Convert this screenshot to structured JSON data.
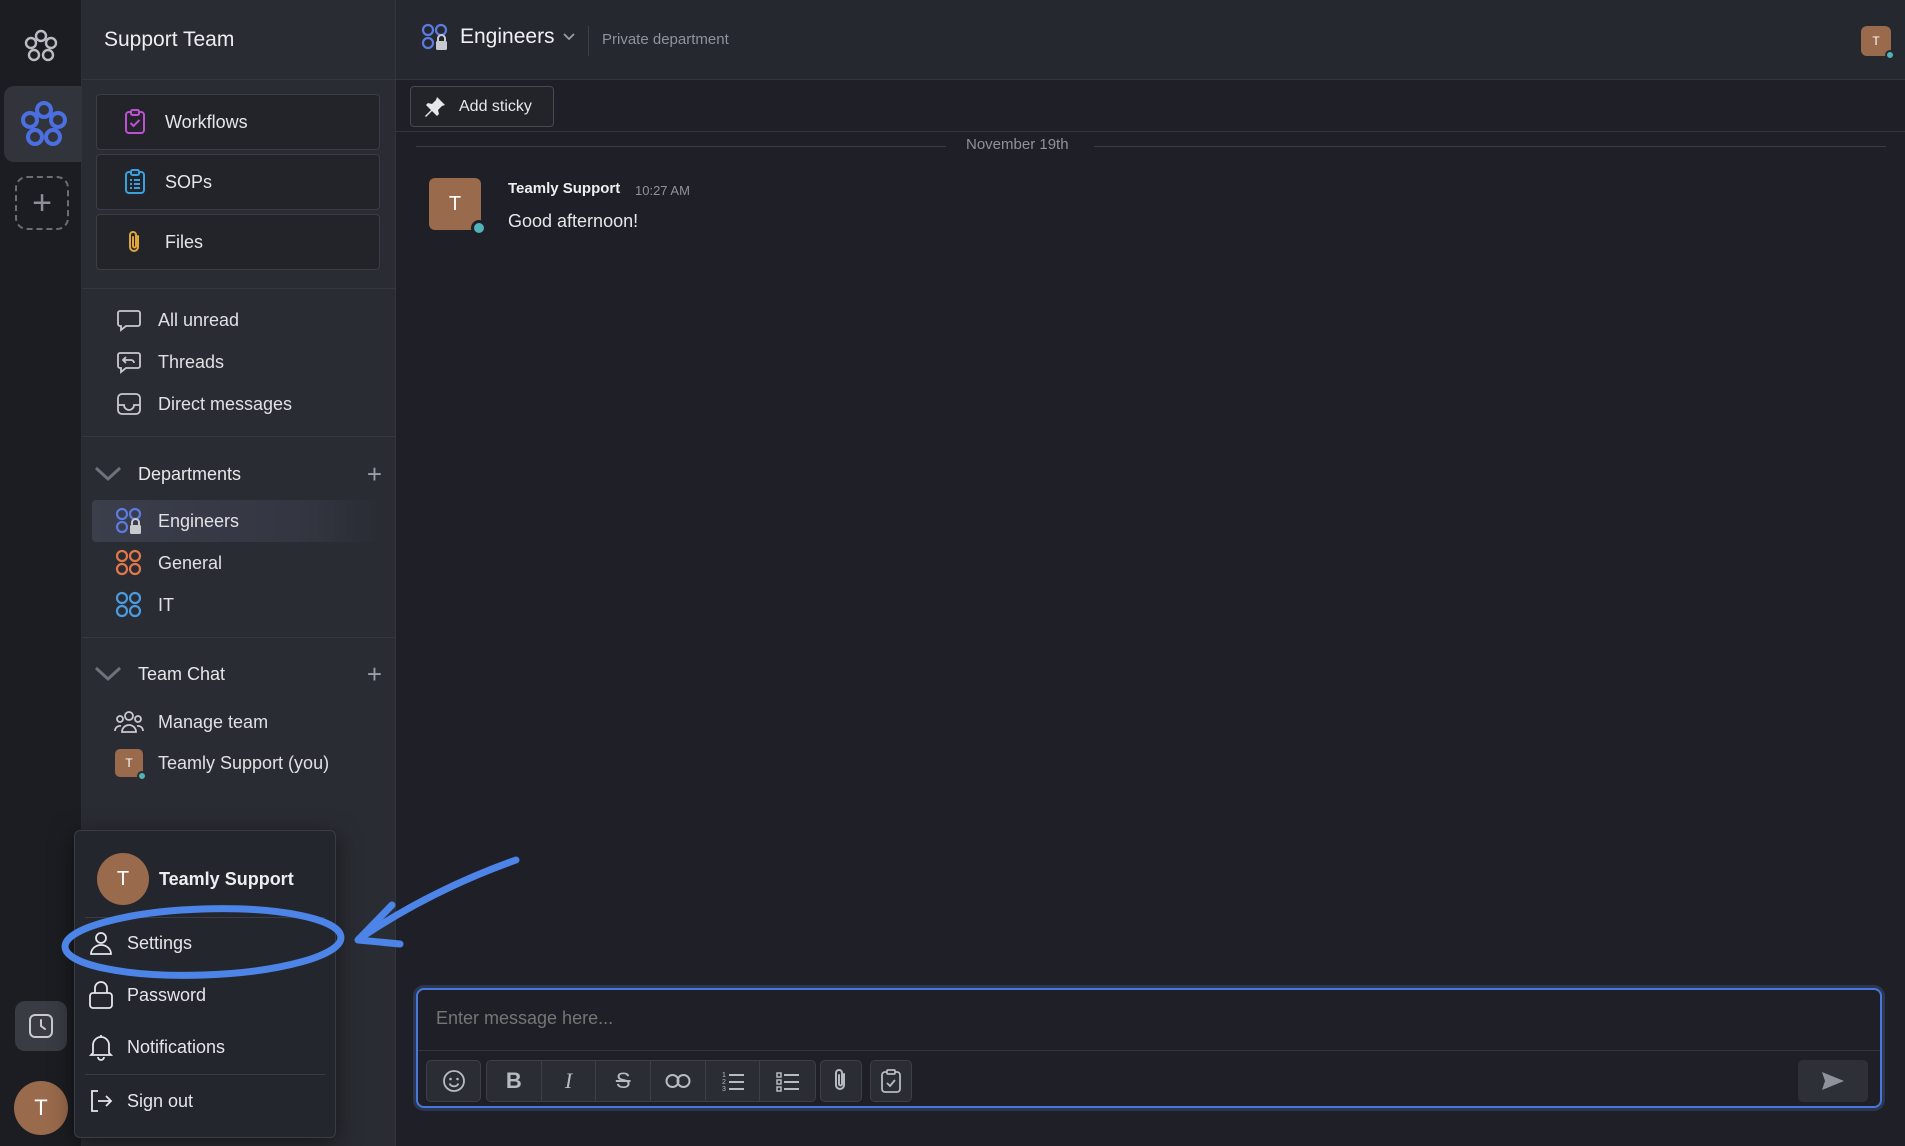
{
  "workspace": {
    "name": "Support Team"
  },
  "rail": {
    "avatar_initial": "T"
  },
  "sidebar": {
    "quick_links": [
      {
        "label": "Workflows",
        "icon": "workflow-icon"
      },
      {
        "label": "SOPs",
        "icon": "sop-icon"
      },
      {
        "label": "Files",
        "icon": "paperclip-icon"
      }
    ],
    "nav": [
      {
        "label": "All unread",
        "icon": "chat-bubble-icon"
      },
      {
        "label": "Threads",
        "icon": "threads-icon"
      },
      {
        "label": "Direct messages",
        "icon": "inbox-icon"
      }
    ],
    "departments": {
      "title": "Departments",
      "items": [
        {
          "label": "Engineers",
          "icon": "private-department-icon",
          "color": "#5b7be0",
          "active": true
        },
        {
          "label": "General",
          "icon": "department-icon",
          "color": "#e0784a"
        },
        {
          "label": "IT",
          "icon": "department-icon",
          "color": "#4a9be0"
        }
      ]
    },
    "team_chat": {
      "title": "Team Chat",
      "items": [
        {
          "label": "Manage team",
          "icon": "team-icon"
        },
        {
          "label": "Teamly Support (you)",
          "icon": "avatar",
          "initial": "T"
        }
      ]
    }
  },
  "channel": {
    "title": "Engineers",
    "description": "Private department",
    "header_avatar": "T"
  },
  "toolbar": {
    "add_sticky": "Add sticky"
  },
  "messages": {
    "date_divider": "November 19th",
    "items": [
      {
        "author": "Teamly Support",
        "time": "10:27 AM",
        "text": "Good afternoon!",
        "initial": "T"
      }
    ]
  },
  "composer": {
    "placeholder": "Enter message here...",
    "format_buttons": [
      "emoji-icon",
      "bold-icon",
      "italic-icon",
      "strikethrough-icon",
      "link-icon",
      "ordered-list-icon",
      "bullet-list-icon",
      "attach-icon",
      "task-icon"
    ],
    "send_icon": "send-icon"
  },
  "user_menu": {
    "name": "Teamly Support",
    "initial": "T",
    "items": [
      {
        "label": "Settings",
        "icon": "user-icon"
      },
      {
        "label": "Password",
        "icon": "lock-icon"
      },
      {
        "label": "Notifications",
        "icon": "bell-icon"
      },
      {
        "label": "Sign out",
        "icon": "sign-out-icon"
      }
    ]
  },
  "colors": {
    "accent": "#4a78d6",
    "annotation": "#4c84e8",
    "avatar": "#9a6a4c",
    "online": "#4fb3b8"
  }
}
